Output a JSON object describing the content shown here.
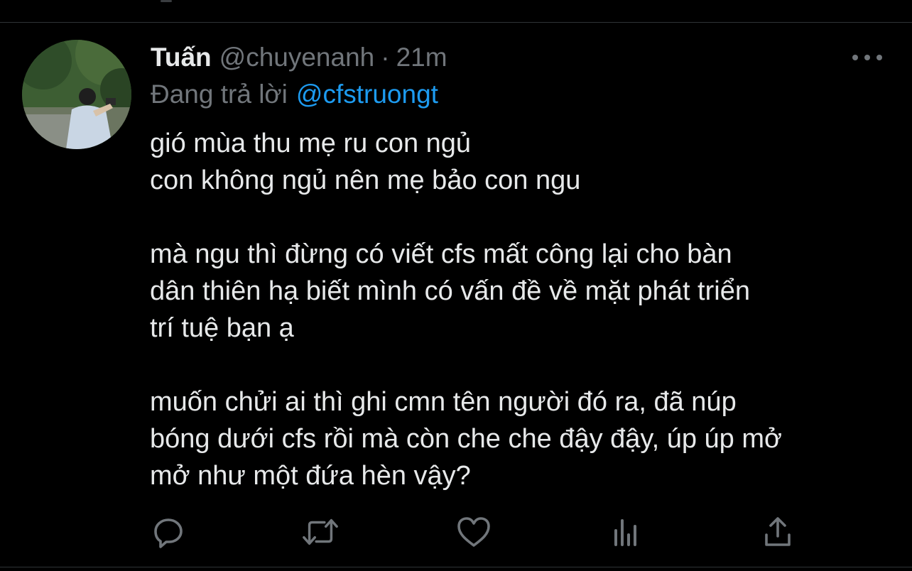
{
  "tweet": {
    "author": {
      "display_name": "Tuấn",
      "handle": "@chuyenanh",
      "separator": "·",
      "time": "21m"
    },
    "reply": {
      "prefix": "Đang trả lời",
      "mention": "@cfstruongt"
    },
    "body_lines": [
      "gió mùa thu mẹ ru con ngủ",
      "con không ngủ nên mẹ bảo con ngu",
      "",
      "mà ngu thì đừng có viết cfs mất công lại cho bàn",
      "dân thiên hạ biết mình có vấn đề về mặt phát triển",
      "trí tuệ bạn ạ",
      "",
      "muốn chửi ai thì ghi cmn tên người đó ra, đã núp",
      "bóng dưới cfs rồi mà còn che che đậy đậy, úp úp mở",
      "mở như một đứa hèn vậy?"
    ],
    "actions": [
      "reply-icon",
      "retweet-icon",
      "like-icon",
      "analytics-icon",
      "share-icon"
    ]
  },
  "colors": {
    "background": "#000000",
    "text_primary": "#e7e9ea",
    "text_secondary": "#71767b",
    "accent": "#1d9bf0",
    "divider": "#2f3336"
  }
}
